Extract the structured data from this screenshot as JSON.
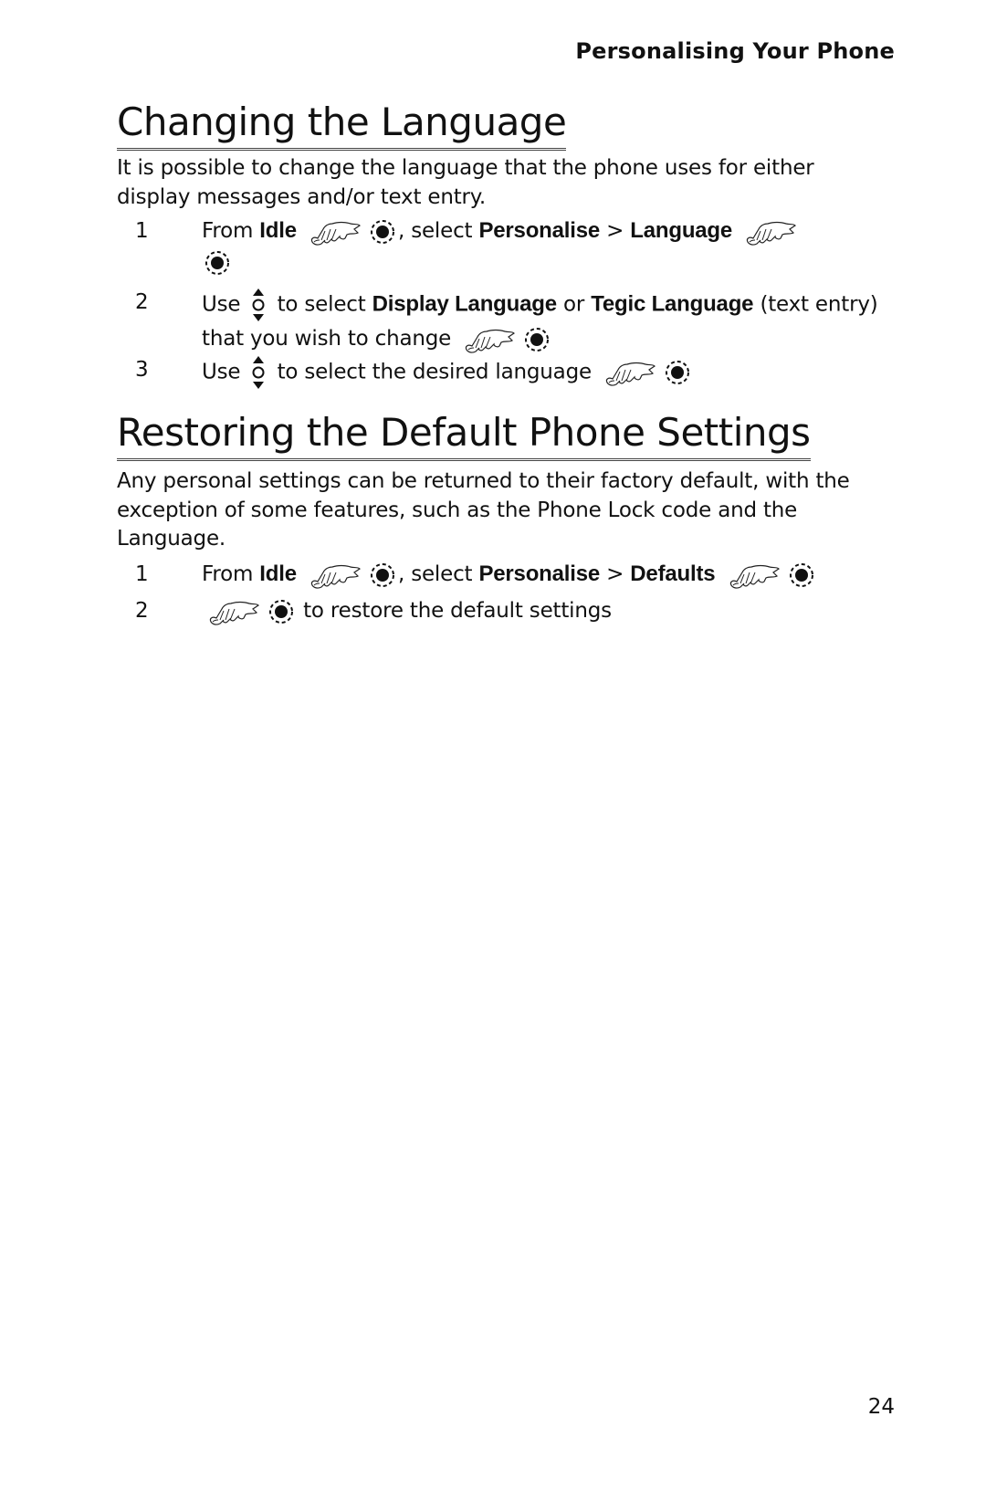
{
  "header": {
    "running_title": "Personalising Your Phone"
  },
  "sections": [
    {
      "title": "Changing the Language",
      "intro": "It is possible to change the language that the phone uses for either display messages and/or text entry.",
      "steps": [
        {
          "num": "1",
          "t1": "From ",
          "b1": "Idle",
          "t2": ", select ",
          "b2": "Personalise",
          "t3": " > ",
          "b3": "Language"
        },
        {
          "num": "2",
          "t1": "Use ",
          "t2": " to select ",
          "b1": "Display Language",
          "t3": " or ",
          "b2": "Tegic Language",
          "t4": " (text entry) that you wish to change"
        },
        {
          "num": "3",
          "t1": "Use ",
          "t2": " to select the desired language"
        }
      ]
    },
    {
      "title": "Restoring the Default Phone Settings",
      "intro": "Any personal settings can be returned to their factory default, with the exception of some features, such as the Phone Lock code and the Language.",
      "steps": [
        {
          "num": "1",
          "t1": "From ",
          "b1": "Idle",
          "t2": ", select ",
          "b2": "Personalise",
          "t3": " > ",
          "b3": "Defaults"
        },
        {
          "num": "2",
          "t1": " to restore the default settings"
        }
      ]
    }
  ],
  "icons": {
    "press": "hand-press-icon",
    "select": "select-key-icon",
    "navigate": "navigation-key-icon"
  },
  "footer": {
    "page_number": "24"
  }
}
